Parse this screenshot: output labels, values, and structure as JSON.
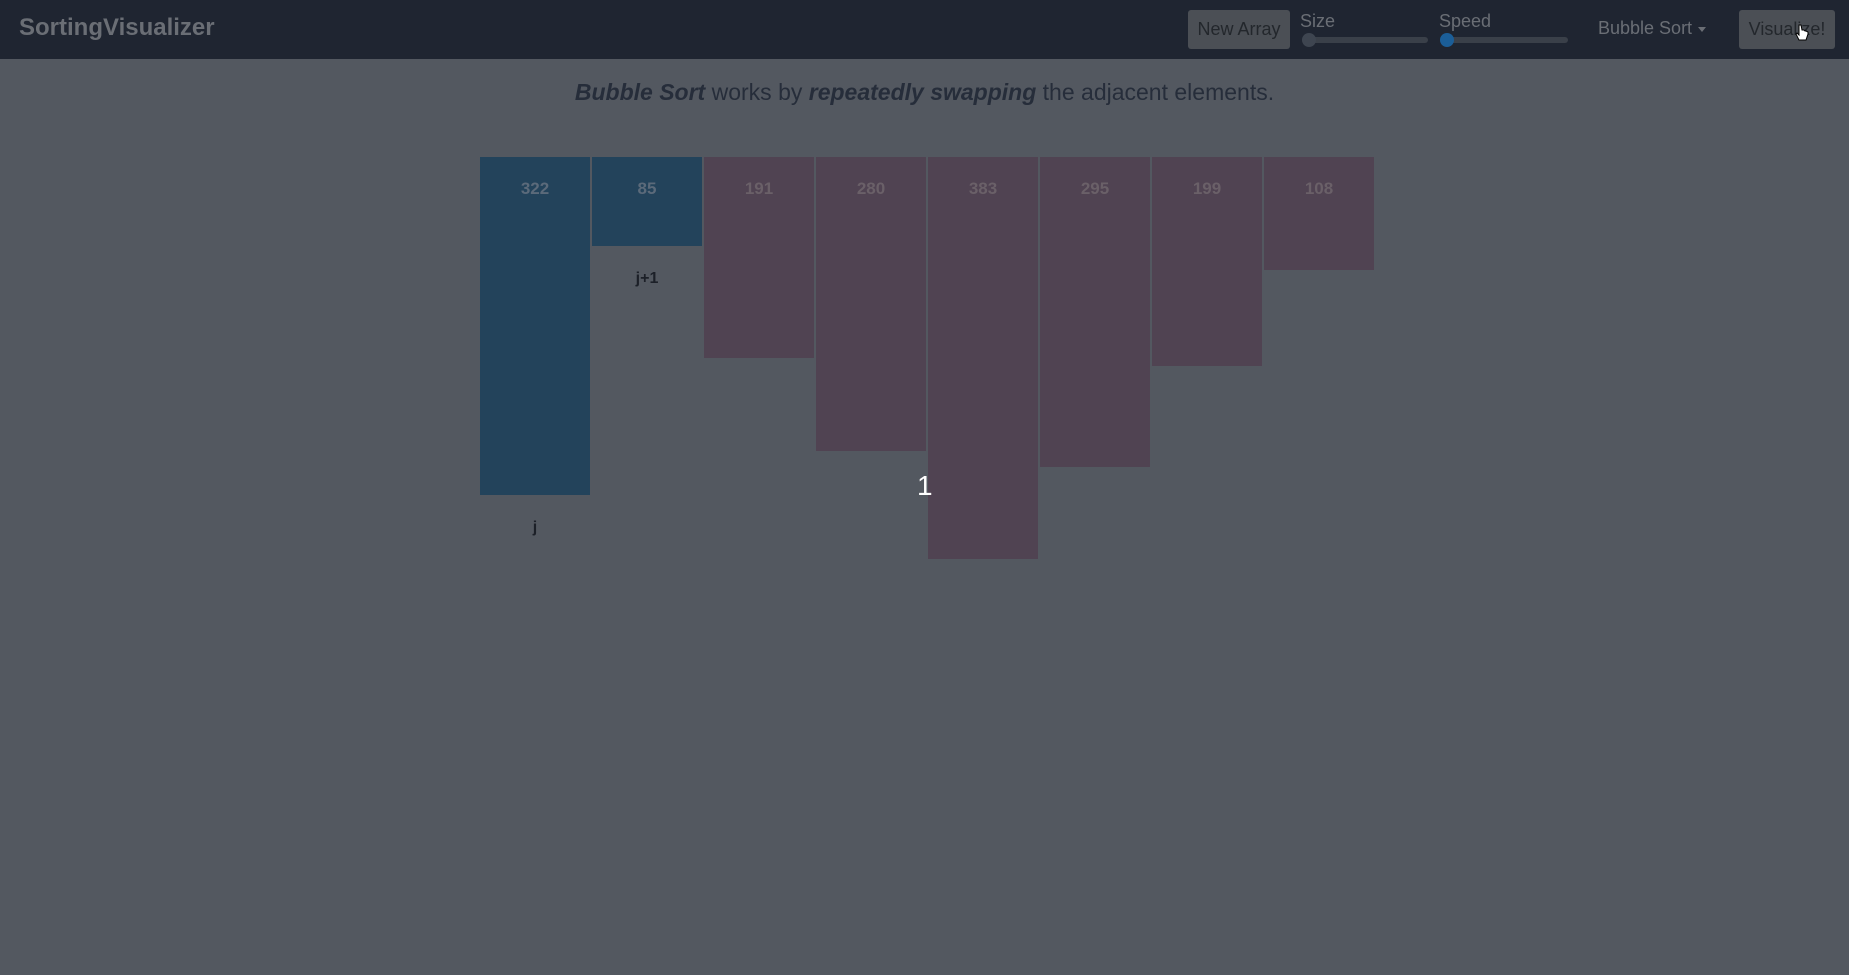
{
  "navbar": {
    "brand": "SortingVisualizer",
    "new_array_label": "New Array",
    "size_label": "Size",
    "speed_label": "Speed",
    "size_value": 0.0,
    "speed_value": 0.0,
    "algorithm_selected": "Bubble Sort",
    "visualize_label": "Visualize!"
  },
  "description": {
    "algo": "Bubble Sort",
    "text1": " works by ",
    "emph": "repeatedly swapping",
    "text2": " the adjacent elements."
  },
  "array": {
    "values": [
      322,
      85,
      191,
      280,
      383,
      295,
      199,
      108
    ],
    "states": [
      "compare",
      "compare",
      "idle",
      "idle",
      "idle",
      "idle",
      "idle",
      "idle"
    ],
    "pointers": {
      "j": 0,
      "j+1": 1
    },
    "pointer_labels": {
      "j": "j",
      "j1": "j+1"
    }
  },
  "pass_counter": "1",
  "colors": {
    "compare": "#23435b",
    "idle": "#504352",
    "compare_text": "#5b6a7a",
    "idle_text": "#6a6068",
    "thumb": "#1b5e98"
  }
}
